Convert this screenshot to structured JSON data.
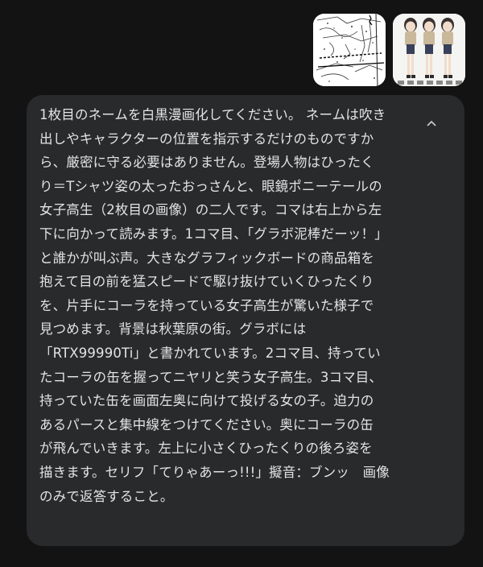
{
  "attachments": [
    {
      "name": "ネーム画像",
      "icon": "sketch-thumbnail"
    },
    {
      "name": "女子高生キャラクター画像",
      "icon": "character-thumbnail"
    }
  ],
  "message": {
    "lines": [
      "1枚目のネームを白黒漫画化してください。 ネームは吹き",
      "出しやキャラクターの位置を指示するだけのものですか",
      "ら、厳密に守る必要はありません。登場人物はひったく",
      "り＝Tシャツ姿の太ったおっさんと、眼鏡ポニーテールの",
      "女子高生（2枚目の画像）の二人です。コマは右上から左",
      "下に向かって読みます。1コマ目、「グラボ泥棒だーッ！」",
      "と誰かが叫ぶ声。大きなグラフィックボードの商品箱を",
      "抱えて目の前を猛スピードで駆け抜けていくひったくり",
      "を、片手にコーラを持っている女子高生が驚いた様子で",
      "見つめます。背景は秋葉原の街。グラボには",
      "「RTX99990Ti」と書かれています。2コマ目、持ってい",
      "たコーラの缶を握ってニヤリと笑う女子高生。3コマ目、",
      "持っていた缶を画面左奥に向けて投げる女の子。迫力の",
      "あるパースと集中線をつけてください。奥にコーラの缶",
      "が飛んでいきます。左上に小さくひったくりの後ろ姿を",
      "描きます。セリフ「てりゃあーっ!!!」擬音：ブンッ　画像",
      "のみで返答すること。"
    ],
    "collapse_icon": "chevron-up-icon"
  },
  "colors": {
    "background": "#131314",
    "bubble": "#282a2c",
    "text": "#e3e3e3"
  }
}
